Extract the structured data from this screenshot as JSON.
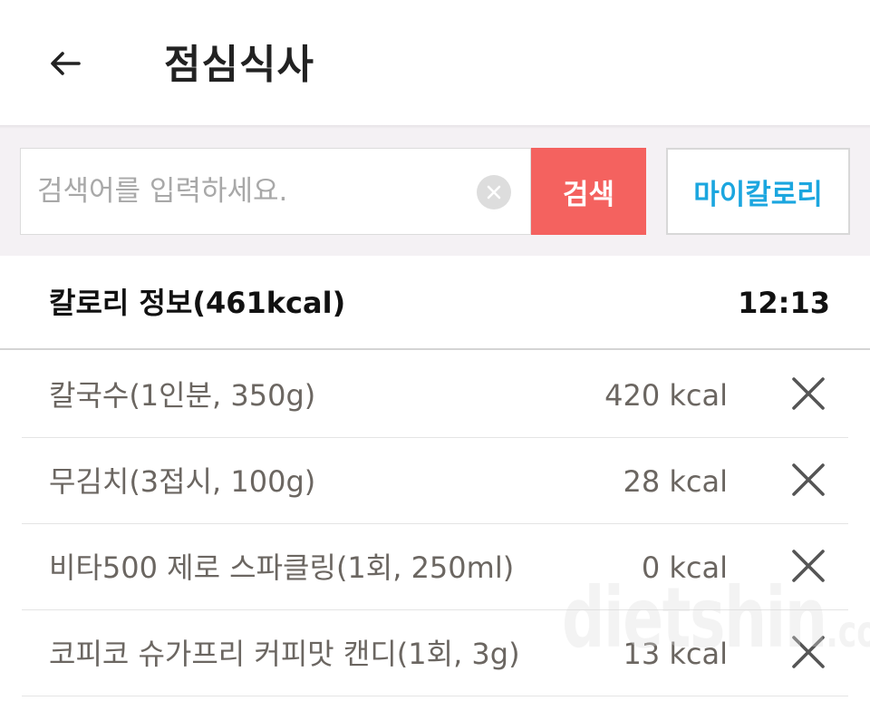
{
  "header": {
    "title": "점심식사",
    "back_icon": "arrow-left-icon"
  },
  "search": {
    "placeholder": "검색어를 입력하세요.",
    "value": "",
    "clear_icon": "clear-circle-icon",
    "button_label": "검색",
    "button_color": "#f4625f",
    "my_calorie_label": "마이칼로리",
    "my_calorie_color": "#1ba6df"
  },
  "info": {
    "title": "칼로리 정보(461kcal)",
    "time": "12:13"
  },
  "foods": [
    {
      "name": "칼국수(1인분, 350g)",
      "kcal": "420 kcal",
      "remove_icon": "close-x-icon"
    },
    {
      "name": "무김치(3접시, 100g)",
      "kcal": "28 kcal",
      "remove_icon": "close-x-icon"
    },
    {
      "name": "비타500 제로 스파클링(1회, 250ml)",
      "kcal": "0 kcal",
      "remove_icon": "close-x-icon"
    },
    {
      "name": "코피코 슈가프리 커피맛 캔디(1회, 3g)",
      "kcal": "13 kcal",
      "remove_icon": "close-x-icon"
    }
  ],
  "watermark": {
    "text": "dietshin",
    "suffix": ".com"
  }
}
